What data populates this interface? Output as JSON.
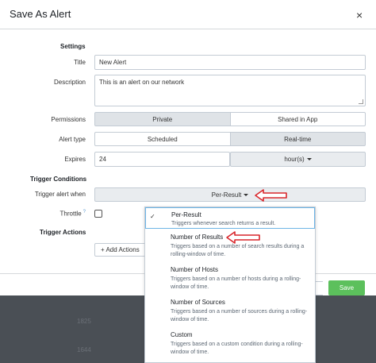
{
  "dialog": {
    "title": "Save As Alert",
    "close_glyph": "×"
  },
  "settings": {
    "heading": "Settings",
    "title_label": "Title",
    "title_value": "New Alert",
    "description_label": "Description",
    "description_value": "This is an alert on our network",
    "permissions_label": "Permissions",
    "permissions_options": [
      "Private",
      "Shared in App"
    ],
    "permissions_selected": "Private",
    "alert_type_label": "Alert type",
    "alert_type_options": [
      "Scheduled",
      "Real-time"
    ],
    "alert_type_selected": "Real-time",
    "expires_label": "Expires",
    "expires_value": "24",
    "expires_unit": "hour(s)"
  },
  "trigger_conditions": {
    "heading": "Trigger Conditions",
    "trigger_when_label": "Trigger alert when",
    "trigger_when_value": "Per-Result",
    "throttle_label": "Throttle",
    "throttle_help": "?",
    "throttle_checked": false
  },
  "trigger_actions": {
    "heading": "Trigger Actions",
    "add_actions_label": "+ Add Actions"
  },
  "footer": {
    "save_label": "Save"
  },
  "trigger_menu": {
    "items": [
      {
        "title": "Per-Result",
        "desc": "Triggers whenever search returns a result.",
        "checkmark": "✓"
      },
      {
        "title": "Number of Results",
        "desc": "Triggers based on a number of search results during a rolling-window of time."
      },
      {
        "title": "Number of Hosts",
        "desc": "Triggers based on a number of hosts during a rolling-window of time."
      },
      {
        "title": "Number of Sources",
        "desc": "Triggers based on a number of sources during a rolling-window of time."
      },
      {
        "title": "Custom",
        "desc": "Triggers based on a custom condition during a rolling-window of time."
      }
    ]
  },
  "background": {
    "numbers": [
      "1825",
      "1644"
    ]
  },
  "colors": {
    "save_green": "#5cc05c",
    "annotation_red": "#d9262b",
    "selected_border": "#6eb5e6"
  }
}
